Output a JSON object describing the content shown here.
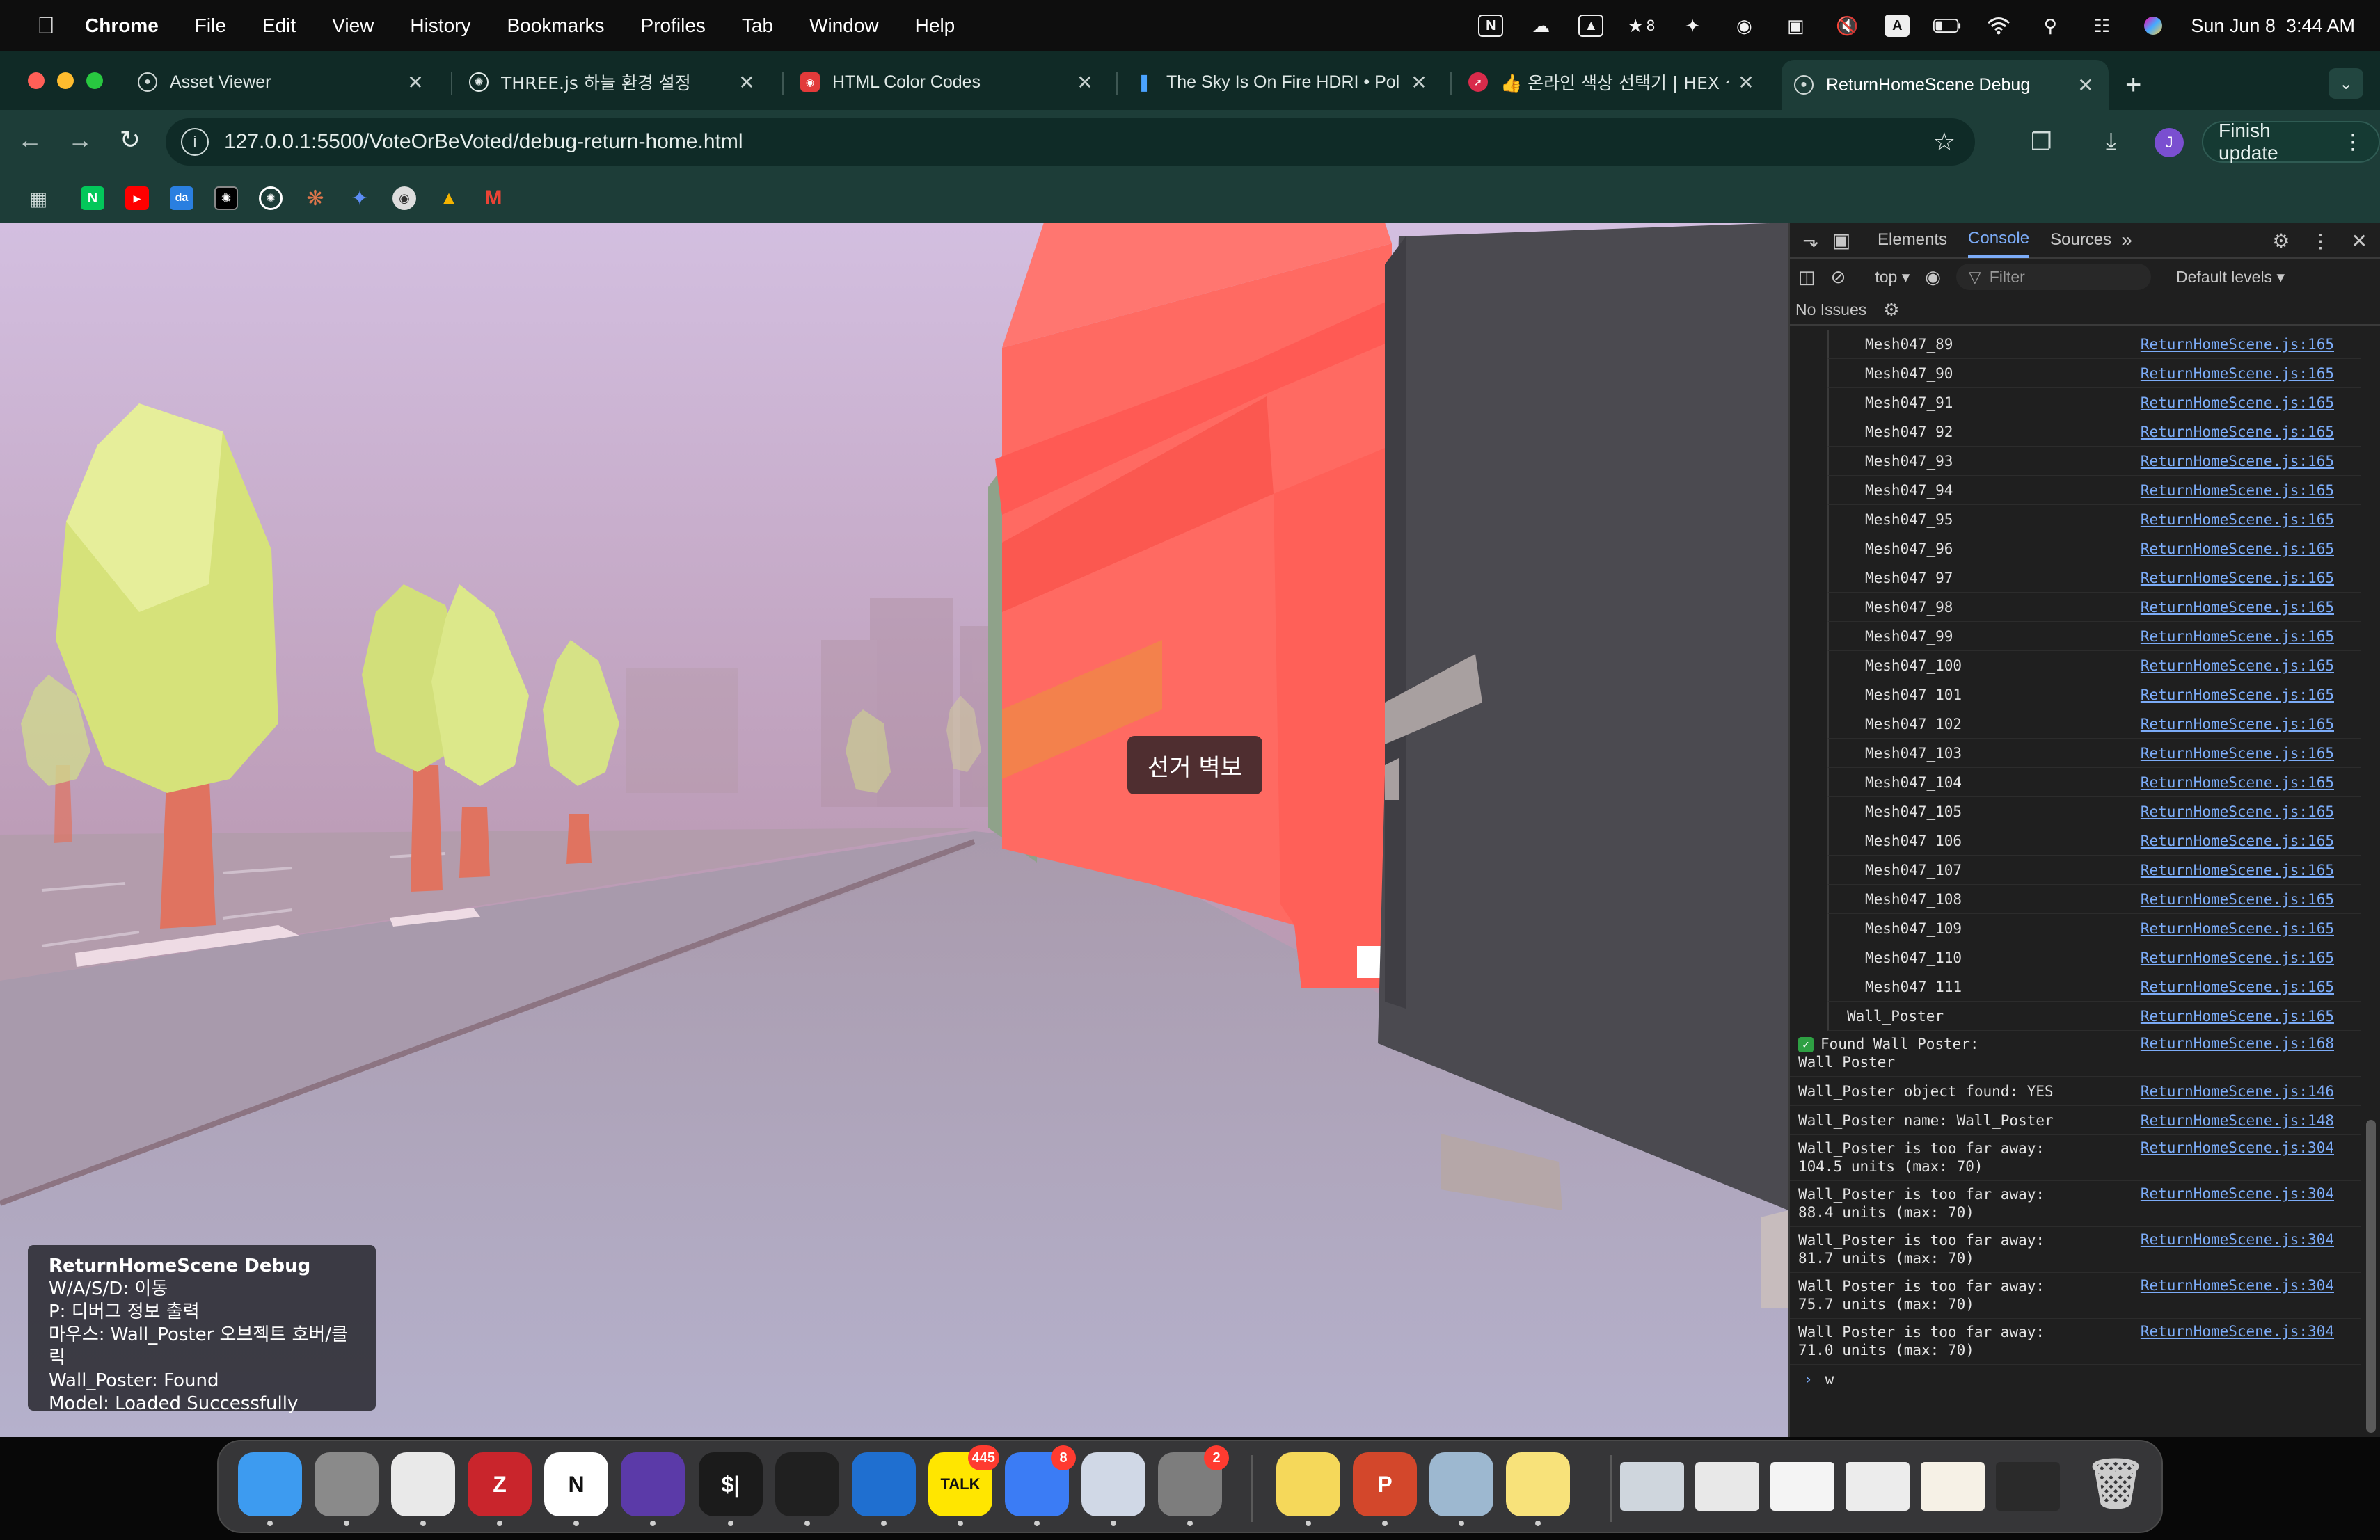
{
  "menubar": {
    "app": "Chrome",
    "items": [
      "File",
      "Edit",
      "View",
      "History",
      "Bookmarks",
      "Profiles",
      "Tab",
      "Window",
      "Help"
    ],
    "battery_icon": "battery-icon",
    "notification_count": "8",
    "datetime": "Sun Jun 8  3:44 AM"
  },
  "tabs": [
    {
      "title": "Asset Viewer",
      "icon": "globe-icon"
    },
    {
      "title": "THREE.js 하늘 환경 설정",
      "icon": "openai-icon"
    },
    {
      "title": "HTML Color Codes",
      "icon": "color-codes-icon"
    },
    {
      "title": "The Sky Is On Fire HDRI • Pol",
      "icon": "polyhaven-icon"
    },
    {
      "title": "👍 온라인 색상 선택기 | HEX 색상",
      "icon": "picker-icon"
    },
    {
      "title": "ReturnHomeScene Debug",
      "icon": "globe-icon"
    }
  ],
  "toolbar": {
    "url": "127.0.0.1:5500/VoteOrBeVoted/debug-return-home.html",
    "finish_update": "Finish update",
    "profile_initial": "J"
  },
  "viewport": {
    "tooltip": "선거 벽보",
    "debug": {
      "title": "ReturnHomeScene Debug",
      "lines": [
        "W/A/S/D: 이동",
        "P: 디버그 정보 출력",
        "마우스: Wall_Poster 오브젝트 호버/클릭",
        "Wall_Poster: Found",
        "Model: Loaded Successfully"
      ]
    }
  },
  "devtools": {
    "tabs": [
      "Elements",
      "Console",
      "Sources"
    ],
    "active_tab": "Console",
    "context": "top",
    "filter_placeholder": "Filter",
    "levels": "Default levels",
    "issues": "No Issues",
    "prompt_input": "w",
    "console_rows": [
      {
        "msg": "Mesh047_89",
        "src": "ReturnHomeScene.js:165",
        "kind": "grp"
      },
      {
        "msg": "Mesh047_90",
        "src": "ReturnHomeScene.js:165",
        "kind": "grp"
      },
      {
        "msg": "Mesh047_91",
        "src": "ReturnHomeScene.js:165",
        "kind": "grp"
      },
      {
        "msg": "Mesh047_92",
        "src": "ReturnHomeScene.js:165",
        "kind": "grp"
      },
      {
        "msg": "Mesh047_93",
        "src": "ReturnHomeScene.js:165",
        "kind": "grp"
      },
      {
        "msg": "Mesh047_94",
        "src": "ReturnHomeScene.js:165",
        "kind": "grp"
      },
      {
        "msg": "Mesh047_95",
        "src": "ReturnHomeScene.js:165",
        "kind": "grp"
      },
      {
        "msg": "Mesh047_96",
        "src": "ReturnHomeScene.js:165",
        "kind": "grp"
      },
      {
        "msg": "Mesh047_97",
        "src": "ReturnHomeScene.js:165",
        "kind": "grp"
      },
      {
        "msg": "Mesh047_98",
        "src": "ReturnHomeScene.js:165",
        "kind": "grp"
      },
      {
        "msg": "Mesh047_99",
        "src": "ReturnHomeScene.js:165",
        "kind": "grp"
      },
      {
        "msg": "Mesh047_100",
        "src": "ReturnHomeScene.js:165",
        "kind": "grp"
      },
      {
        "msg": "Mesh047_101",
        "src": "ReturnHomeScene.js:165",
        "kind": "grp"
      },
      {
        "msg": "Mesh047_102",
        "src": "ReturnHomeScene.js:165",
        "kind": "grp"
      },
      {
        "msg": "Mesh047_103",
        "src": "ReturnHomeScene.js:165",
        "kind": "grp"
      },
      {
        "msg": "Mesh047_104",
        "src": "ReturnHomeScene.js:165",
        "kind": "grp"
      },
      {
        "msg": "Mesh047_105",
        "src": "ReturnHomeScene.js:165",
        "kind": "grp"
      },
      {
        "msg": "Mesh047_106",
        "src": "ReturnHomeScene.js:165",
        "kind": "grp"
      },
      {
        "msg": "Mesh047_107",
        "src": "ReturnHomeScene.js:165",
        "kind": "grp"
      },
      {
        "msg": "Mesh047_108",
        "src": "ReturnHomeScene.js:165",
        "kind": "grp"
      },
      {
        "msg": "Mesh047_109",
        "src": "ReturnHomeScene.js:165",
        "kind": "grp"
      },
      {
        "msg": "Mesh047_110",
        "src": "ReturnHomeScene.js:165",
        "kind": "grp"
      },
      {
        "msg": "Mesh047_111",
        "src": "ReturnHomeScene.js:165",
        "kind": "grp"
      },
      {
        "msg": "Wall_Poster",
        "src": "ReturnHomeScene.js:165",
        "kind": "grp0"
      },
      {
        "msg": "Found Wall_Poster:\nWall_Poster",
        "src": "ReturnHomeScene.js:168",
        "kind": "check"
      },
      {
        "msg": "Wall_Poster object found: YES",
        "src": "ReturnHomeScene.js:146",
        "kind": "top"
      },
      {
        "msg": "Wall_Poster name: Wall_Poster",
        "src": "ReturnHomeScene.js:148",
        "kind": "top"
      },
      {
        "msg": "Wall_Poster is too far away:\n104.5 units (max: 70)",
        "src": "ReturnHomeScene.js:304",
        "kind": "top2"
      },
      {
        "msg": "Wall_Poster is too far away:\n88.4 units (max: 70)",
        "src": "ReturnHomeScene.js:304",
        "kind": "top2"
      },
      {
        "msg": "Wall_Poster is too far away:\n81.7 units (max: 70)",
        "src": "ReturnHomeScene.js:304",
        "kind": "top2"
      },
      {
        "msg": "Wall_Poster is too far away:\n75.7 units (max: 70)",
        "src": "ReturnHomeScene.js:304",
        "kind": "top2"
      },
      {
        "msg": "Wall_Poster is too far away:\n71.0 units (max: 70)",
        "src": "ReturnHomeScene.js:304",
        "kind": "top2"
      }
    ]
  },
  "dock": {
    "apps": [
      {
        "name": "finder",
        "label": "",
        "color": "#3d9bf0"
      },
      {
        "name": "launchpad",
        "label": "",
        "color": "#8a8a8a"
      },
      {
        "name": "chrome",
        "label": "",
        "color": "#e9e9e9"
      },
      {
        "name": "zotero",
        "label": "Z",
        "color": "#c9252c"
      },
      {
        "name": "notion",
        "label": "N",
        "color": "#ffffff"
      },
      {
        "name": "obsidian",
        "label": "",
        "color": "#5b3aa8"
      },
      {
        "name": "terminal",
        "label": "$|",
        "color": "#1b1b1b"
      },
      {
        "name": "unity",
        "label": "",
        "color": "#202020"
      },
      {
        "name": "vscode",
        "label": "",
        "color": "#1f6fd0"
      },
      {
        "name": "kakaotalk",
        "label": "TALK",
        "color": "#ffe600",
        "badge": "445"
      },
      {
        "name": "spark-mail",
        "label": "",
        "color": "#3b7cf5",
        "badge": "8"
      },
      {
        "name": "iphone-mirroring",
        "label": "",
        "color": "#d0d8e6"
      },
      {
        "name": "system-settings",
        "label": "",
        "color": "#7d7d7d",
        "badge": "2"
      },
      {
        "name": "stickies",
        "label": "",
        "color": "#f5d85a"
      },
      {
        "name": "powerpoint",
        "label": "P",
        "color": "#d3472b"
      },
      {
        "name": "preview",
        "label": "",
        "color": "#9db8d0"
      },
      {
        "name": "notes",
        "label": "",
        "color": "#f8e27a"
      }
    ]
  }
}
